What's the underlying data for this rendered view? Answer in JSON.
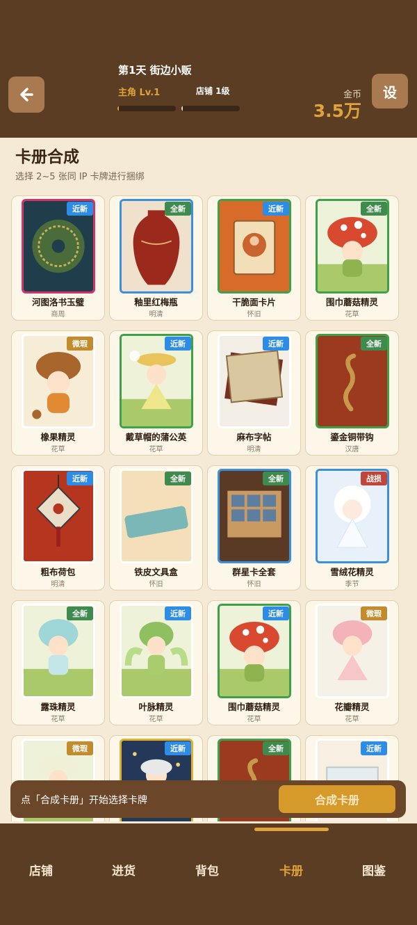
{
  "header": {
    "day_title": "第1天 街边小贩",
    "role_level": "主角 Lv.1",
    "shop_level": "店铺 1级",
    "role_progress": 0.02,
    "shop_progress": 0.02,
    "coin_label": "金币",
    "coin_value": "3.5万",
    "back_icon": "arrow-left-icon",
    "settings_label": "设"
  },
  "section": {
    "title": "卡册合成",
    "subtitle": "选择 2~5 张同 IP 卡牌进行捆绑"
  },
  "cards": [
    {
      "name": "河图洛书玉璧",
      "tag": "商周",
      "badge": "近新",
      "badge_color": "#2d8de6",
      "frame": "#d0346b",
      "art": "jade-disc"
    },
    {
      "name": "釉里红梅瓶",
      "tag": "明清",
      "badge": "全新",
      "badge_color": "#3f8a4d",
      "frame": "#3b8fdc",
      "art": "vase"
    },
    {
      "name": "干脆面卡片",
      "tag": "怀旧",
      "badge": "近新",
      "badge_color": "#2d8de6",
      "frame": "#3fa04a",
      "art": "trading-card"
    },
    {
      "name": "围巾蘑菇精灵",
      "tag": "花草",
      "badge": "全新",
      "badge_color": "#3f8a4d",
      "frame": "#3fa04a",
      "art": "mushroom-sprite"
    },
    {
      "name": "橡果精灵",
      "tag": "花草",
      "badge": "微瑕",
      "badge_color": "#c28b2c",
      "frame": "#ffffff",
      "art": "acorn-sprite"
    },
    {
      "name": "戴草帽的蒲公英",
      "tag": "花草",
      "badge": "近新",
      "badge_color": "#2d8de6",
      "frame": "#3fa04a",
      "art": "dandelion-sprite"
    },
    {
      "name": "麻布字帖",
      "tag": "明清",
      "badge": "近新",
      "badge_color": "#2d8de6",
      "frame": "#ffffff",
      "art": "cloth"
    },
    {
      "name": "鎏金铜带钩",
      "tag": "汉唐",
      "badge": "全新",
      "badge_color": "#3f8a4d",
      "frame": "#3fa04a",
      "art": "belt-hook"
    },
    {
      "name": "粗布荷包",
      "tag": "明清",
      "badge": "近新",
      "badge_color": "#2d8de6",
      "frame": "#ffffff",
      "art": "pouch"
    },
    {
      "name": "铁皮文具盒",
      "tag": "怀旧",
      "badge": "全新",
      "badge_color": "#3f8a4d",
      "frame": "#ffffff",
      "art": "pencil-box"
    },
    {
      "name": "群星卡全套",
      "tag": "怀旧",
      "badge": "全新",
      "badge_color": "#3f8a4d",
      "frame": "#3b8fdc",
      "art": "card-set"
    },
    {
      "name": "雪绒花精灵",
      "tag": "季节",
      "badge": "战损",
      "badge_color": "#c0453a",
      "frame": "#3b8fdc",
      "art": "snow-sprite"
    },
    {
      "name": "露珠精灵",
      "tag": "花草",
      "badge": "全新",
      "badge_color": "#3f8a4d",
      "frame": "#ffffff",
      "art": "dew-sprite"
    },
    {
      "name": "叶脉精灵",
      "tag": "花草",
      "badge": "近新",
      "badge_color": "#2d8de6",
      "frame": "#ffffff",
      "art": "leaf-sprite"
    },
    {
      "name": "围巾蘑菇精灵",
      "tag": "花草",
      "badge": "近新",
      "badge_color": "#2d8de6",
      "frame": "#3fa04a",
      "art": "mushroom-sprite"
    },
    {
      "name": "花瓣精灵",
      "tag": "花草",
      "badge": "微瑕",
      "badge_color": "#c28b2c",
      "frame": "#ffffff",
      "art": "petal-sprite"
    },
    {
      "name": "",
      "tag": "",
      "badge": "微瑕",
      "badge_color": "#c28b2c",
      "frame": "#ffffff",
      "art": "flower-sprite"
    },
    {
      "name": "",
      "tag": "",
      "badge": "近新",
      "badge_color": "#2d8de6",
      "frame": "#e0b030",
      "art": "night-sprite"
    },
    {
      "name": "",
      "tag": "",
      "badge": "全新",
      "badge_color": "#3f8a4d",
      "frame": "#3fa04a",
      "art": "belt-hook"
    },
    {
      "name": "",
      "tag": "",
      "badge": "近新",
      "badge_color": "#2d8de6",
      "frame": "#ffffff",
      "art": "glass"
    }
  ],
  "action_bar": {
    "hint": "点「合成卡册」开始选择卡牌",
    "merge_label": "合成卡册"
  },
  "nav": {
    "items": [
      "店铺",
      "进货",
      "背包",
      "卡册",
      "图鉴"
    ],
    "active_index": 3
  }
}
